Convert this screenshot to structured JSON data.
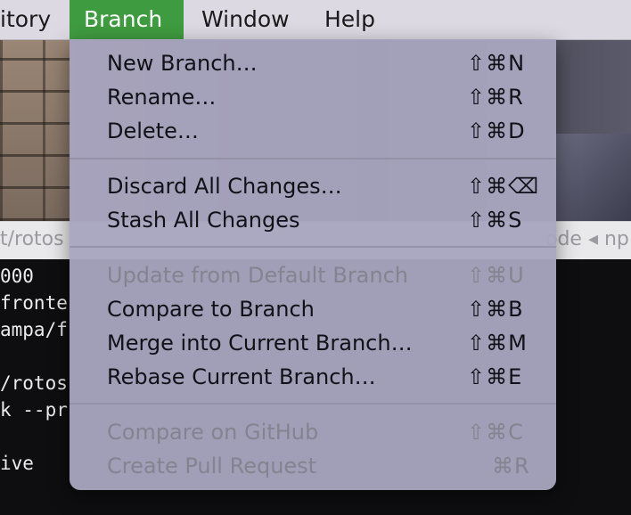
{
  "menubar": {
    "items": [
      {
        "label": "itory"
      },
      {
        "label": "Branch"
      },
      {
        "label": "Window"
      },
      {
        "label": "Help"
      }
    ]
  },
  "pathbar": {
    "left_text": "t/rotos",
    "right_text": "ode ◂ np"
  },
  "terminal": {
    "lines": [
      "000",
      "fronte",
      "ampa/f",
      "",
      "/rotos",
      "k --pr",
      "",
      "ive"
    ]
  },
  "branch_menu": {
    "groups": [
      [
        {
          "label": "New Branch…",
          "shortcut": "⇧⌘N",
          "enabled": true
        },
        {
          "label": "Rename…",
          "shortcut": "⇧⌘R",
          "enabled": true
        },
        {
          "label": "Delete…",
          "shortcut": "⇧⌘D",
          "enabled": true
        }
      ],
      [
        {
          "label": "Discard All Changes…",
          "shortcut": "⇧⌘⌫",
          "enabled": true
        },
        {
          "label": "Stash All Changes",
          "shortcut": "⇧⌘S",
          "enabled": true
        }
      ],
      [
        {
          "label": "Update from Default Branch",
          "shortcut": "⇧⌘U",
          "enabled": false
        },
        {
          "label": "Compare to Branch",
          "shortcut": "⇧⌘B",
          "enabled": true
        },
        {
          "label": "Merge into Current Branch…",
          "shortcut": "⇧⌘M",
          "enabled": true
        },
        {
          "label": "Rebase Current Branch…",
          "shortcut": "⇧⌘E",
          "enabled": true
        }
      ],
      [
        {
          "label": "Compare on GitHub",
          "shortcut": "⇧⌘C",
          "enabled": false
        },
        {
          "label": "Create Pull Request",
          "shortcut": "⌘R",
          "enabled": false
        }
      ]
    ]
  },
  "colors": {
    "active_menu": "#3f9b3f",
    "menu_background": "#a8a4be",
    "disabled_text": "#85838f"
  }
}
